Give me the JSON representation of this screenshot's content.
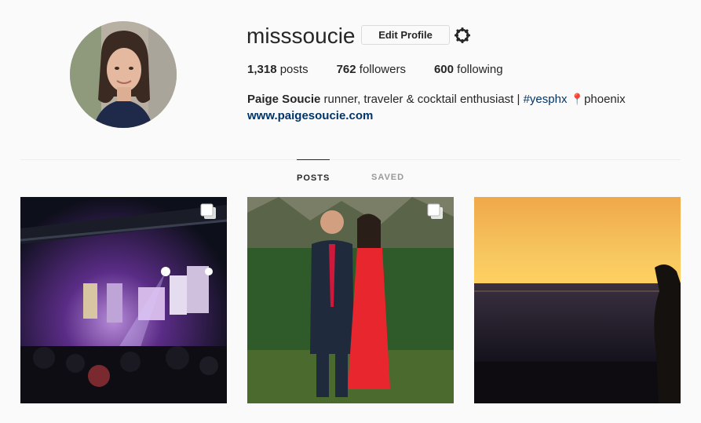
{
  "profile": {
    "username": "misssoucie",
    "edit_label": "Edit Profile",
    "settings_icon": "gear-icon",
    "stats": {
      "posts_count": "1,318",
      "posts_label": "posts",
      "followers_count": "762",
      "followers_label": "followers",
      "following_count": "600",
      "following_label": "following"
    },
    "bio": {
      "name": "Paige Soucie",
      "text": "runner, traveler & cocktail enthusiast |",
      "hashtag": "#yesphx",
      "pin_icon": "📍",
      "location": "phoenix",
      "website": "www.paigesoucie.com"
    }
  },
  "tabs": [
    {
      "label": "POSTS",
      "active": true
    },
    {
      "label": "SAVED",
      "active": false
    }
  ],
  "posts": [
    {
      "subject": "concert stage",
      "multiple": true
    },
    {
      "subject": "couple formal",
      "multiple": true
    },
    {
      "subject": "ocean sunset",
      "multiple": false
    }
  ],
  "colors": {
    "link": "#003569",
    "text": "#262626",
    "muted": "#999999",
    "border": "#dbdbdb"
  }
}
